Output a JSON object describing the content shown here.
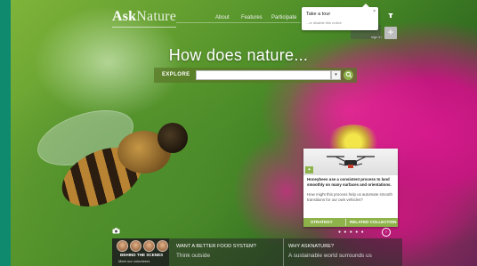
{
  "colors": {
    "brand_green": "#0f8a6e",
    "accent_green": "#8fb34b"
  },
  "header": {
    "logo_part1": "Ask",
    "logo_part2": "Nature",
    "nav": [
      "About",
      "Features",
      "Participate"
    ]
  },
  "tour_popup": {
    "title": "Take a tour",
    "subtitle": "...or disable this notice",
    "close_glyph": "×"
  },
  "account": {
    "signin_label": "sign in",
    "plus_glyph": "+",
    "top_icon": "pin-icon"
  },
  "hero": {
    "headline": "How does nature...",
    "explore_label": "EXPLORE",
    "search_value": "",
    "search_placeholder": ""
  },
  "featured_card": {
    "lead": "Honeybees use a consistent process to land smoothly on many surfaces and orientations.",
    "body": "How might this process help us automate smooth transitions for our own vehicles?",
    "actions": [
      "STRATEGY",
      "RELATED COLLECTION"
    ]
  },
  "bottom": {
    "behind_title": "BEHIND THE SCENES",
    "behind_sub": "Meet our volunteers",
    "col1_title": "WANT A BETTER FOOD SYSTEM?",
    "col1_sub": "Think outside",
    "col2_title": "WHY ASKNATURE?",
    "col2_sub": "A sustainable world surrounds us"
  }
}
